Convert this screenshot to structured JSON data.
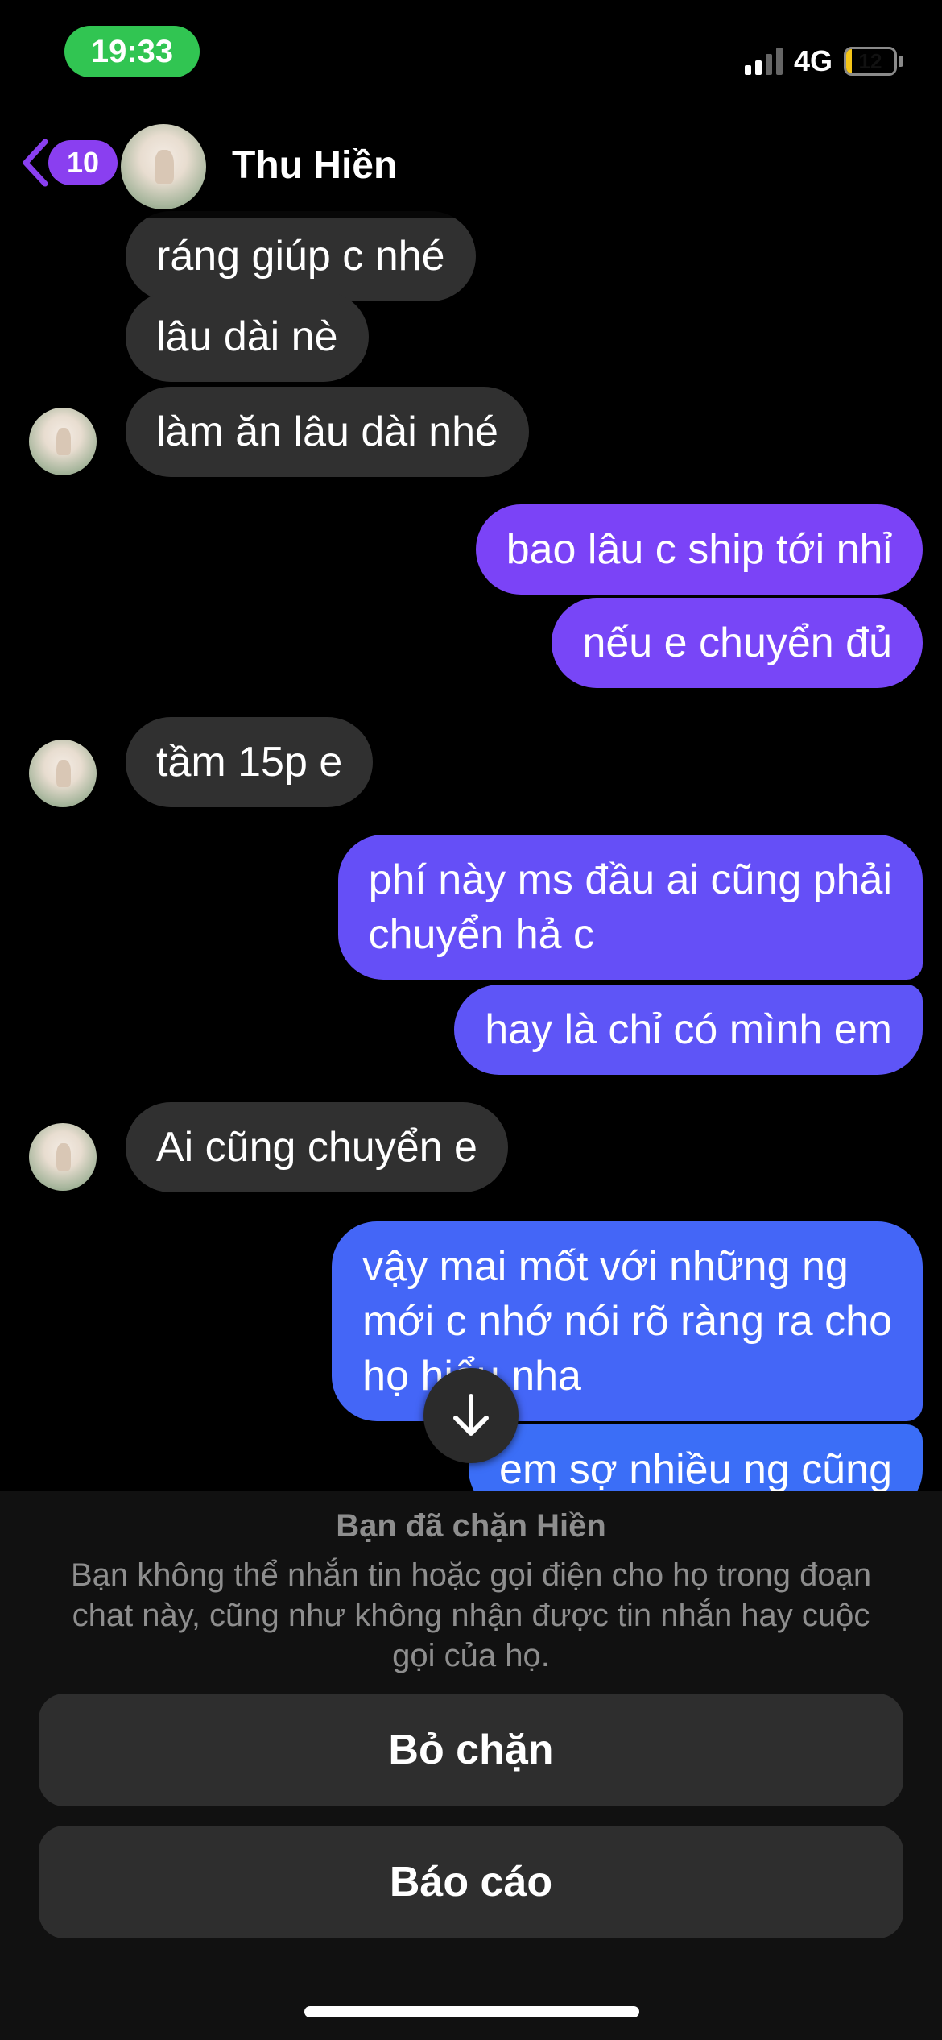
{
  "status_bar": {
    "time": "19:33",
    "network": "4G",
    "battery": "12",
    "battery_level": 0.12
  },
  "header": {
    "back_count": "10",
    "contact_name": "Thu Hiền"
  },
  "messages": [
    {
      "side": "in",
      "text": "ráng giúp c nhé"
    },
    {
      "side": "in",
      "text": "lâu dài nè"
    },
    {
      "side": "in",
      "text": "làm ăn lâu dài nhé"
    },
    {
      "side": "out",
      "text": "bao lâu c ship tới nhỉ"
    },
    {
      "side": "out",
      "text": "nếu e chuyển đủ"
    },
    {
      "side": "in",
      "text": "tầm 15p e"
    },
    {
      "side": "out",
      "text": "phí này ms đầu ai cũng phải\nchuyển hả c"
    },
    {
      "side": "out",
      "text": "hay là chỉ có mình em"
    },
    {
      "side": "in",
      "text": "Ai cũng chuyển e"
    },
    {
      "side": "out",
      "text": "vậy mai mốt với những ng\nmới c nhớ nói rõ ràng ra cho\nhọ hiểu nha"
    },
    {
      "side": "out",
      "text": "em sợ nhiều ng cũng"
    }
  ],
  "block_panel": {
    "title": "Bạn đã chặn Hiền",
    "description": "Bạn không thể nhắn tin hoặc gọi điện cho họ trong đoạn chat này, cũng như không nhận được tin nhắn hay cuộc gọi của họ.",
    "unblock_label": "Bỏ chặn",
    "report_label": "Báo cáo"
  },
  "colors": {
    "accent": "#8a3ff0",
    "incoming_bubble": "#303030",
    "outgoing_top": "#7b43f7",
    "outgoing_bottom": "#3b6ef7"
  }
}
